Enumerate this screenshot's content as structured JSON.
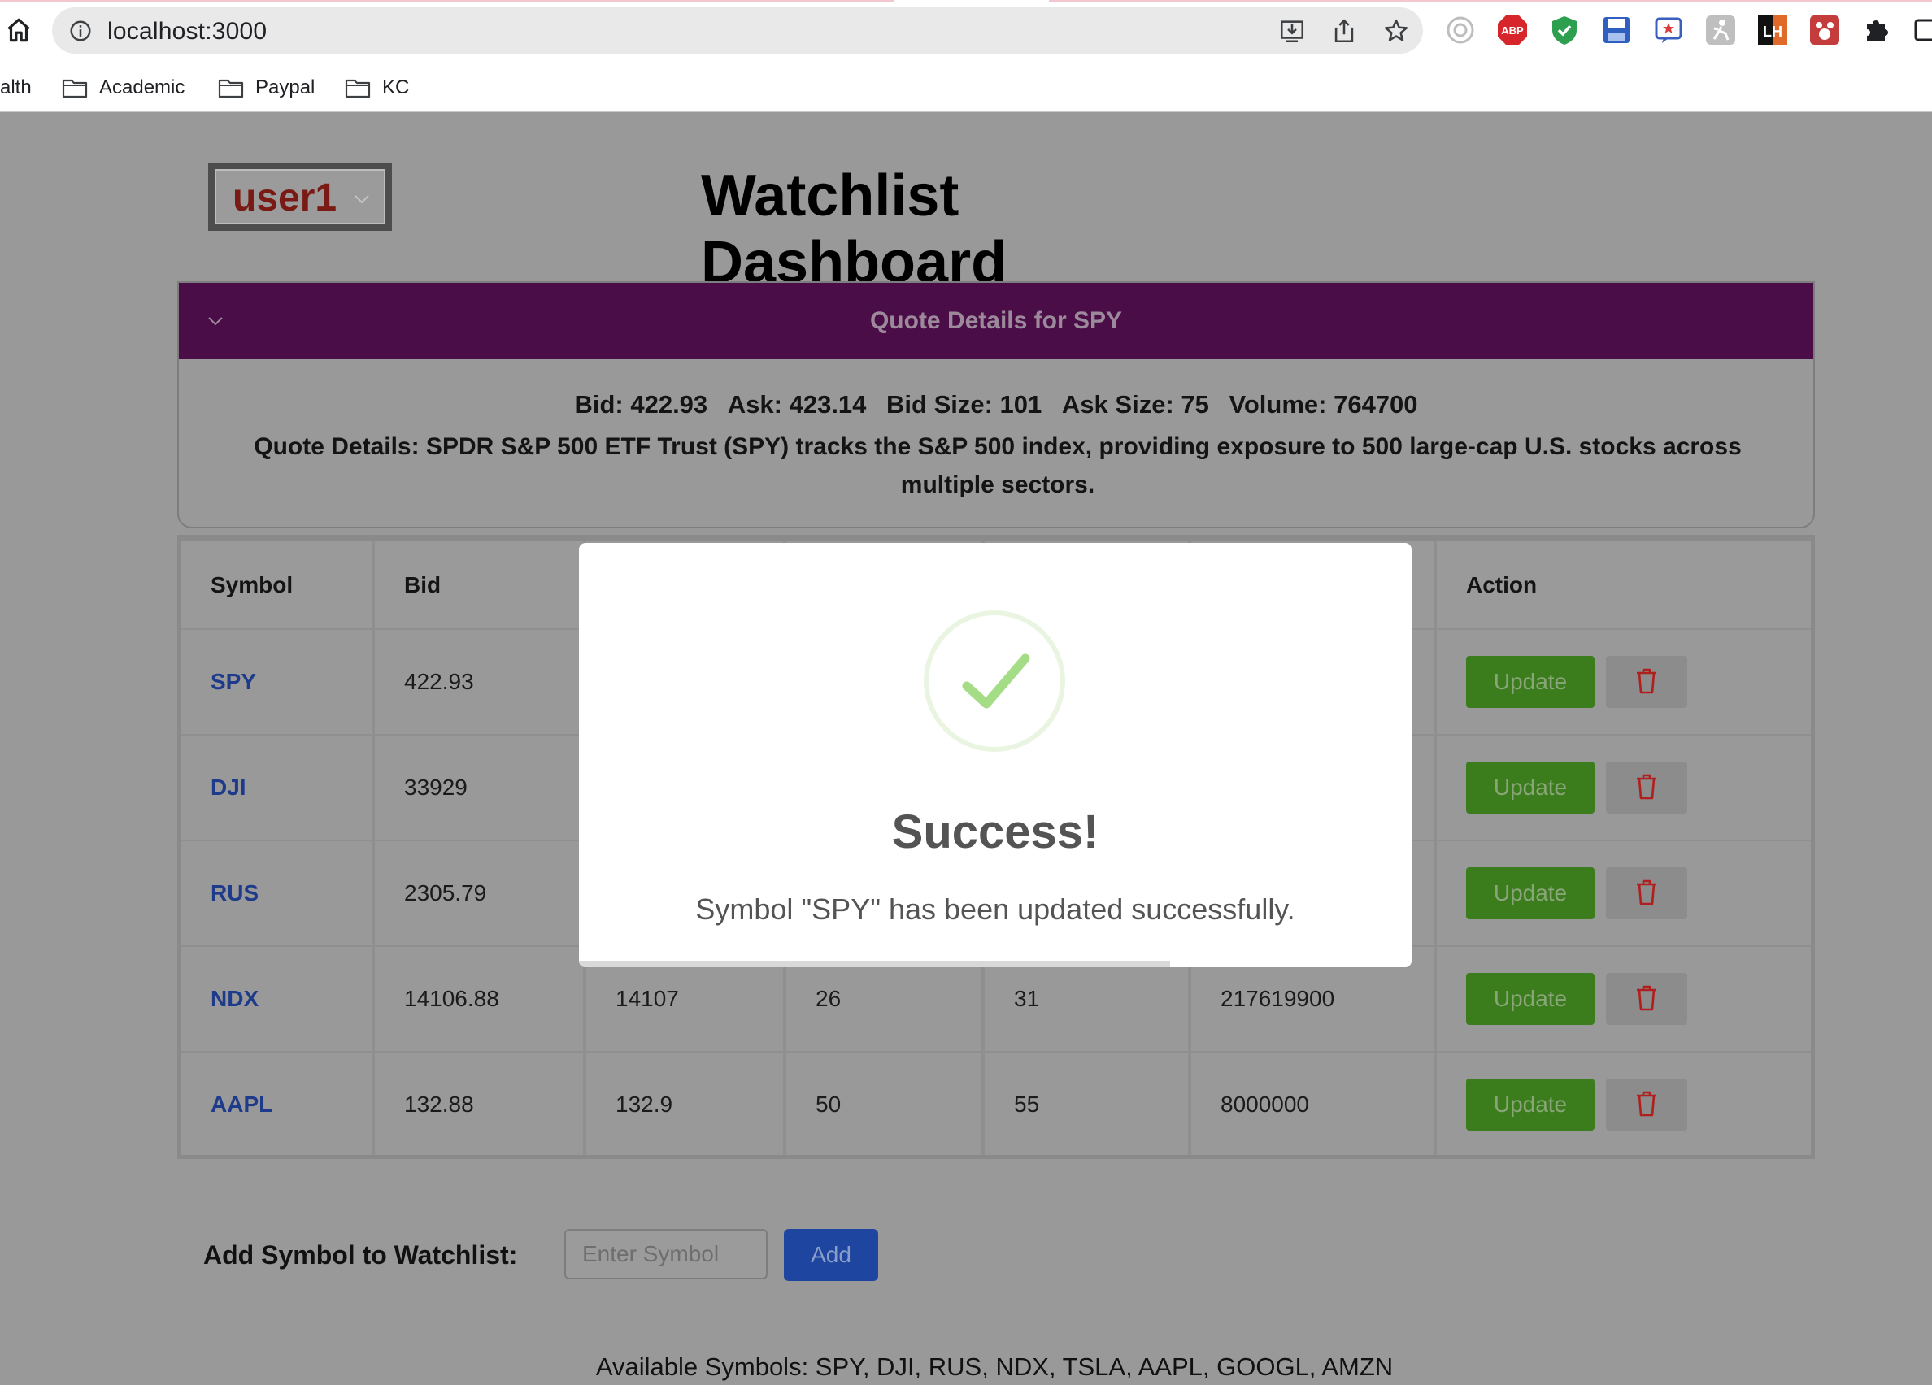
{
  "browser": {
    "url": "localhost:3000",
    "bookmarks": [
      {
        "label": "alth",
        "folder": false
      },
      {
        "label": "Academic",
        "folder": true
      },
      {
        "label": "Paypal",
        "folder": true
      },
      {
        "label": "KC",
        "folder": true
      }
    ],
    "extensions": [
      {
        "icon": "tracker-icon",
        "label": ""
      },
      {
        "icon": "adblock-icon",
        "label": "ABP"
      },
      {
        "icon": "shield-check-icon",
        "label": ""
      },
      {
        "icon": "floppy-disk-icon",
        "label": ""
      },
      {
        "icon": "star-note-icon",
        "label": ""
      },
      {
        "icon": "figure-icon",
        "label": ""
      },
      {
        "icon": "lighthouse-icon",
        "label": "LH"
      },
      {
        "icon": "paw-icon",
        "label": ""
      },
      {
        "icon": "puzzle-icon",
        "label": ""
      },
      {
        "icon": "side-panel-icon",
        "label": ""
      }
    ]
  },
  "header": {
    "user_selected": "user1",
    "title": "Watchlist Dashboard"
  },
  "quote": {
    "title": "Quote Details for SPY",
    "stats": {
      "bid": "Bid: 422.93",
      "ask": "Ask: 423.14",
      "bid_size": "Bid Size: 101",
      "ask_size": "Ask Size: 75",
      "volume": "Volume: 764700"
    },
    "description": "Quote Details: SPDR S&P 500 ETF Trust (SPY) tracks the S&P 500 index, providing exposure to 500 large-cap U.S. stocks across multiple sectors."
  },
  "table": {
    "columns": [
      "Symbol",
      "Bid",
      "",
      "",
      "",
      "",
      "Action"
    ],
    "rows": [
      {
        "symbol": "SPY",
        "bid": "422.93",
        "ask": "",
        "bid_size": "",
        "ask_size": "",
        "volume": ""
      },
      {
        "symbol": "DJI",
        "bid": "33929",
        "ask": "",
        "bid_size": "",
        "ask_size": "",
        "volume": ""
      },
      {
        "symbol": "RUS",
        "bid": "2305.79",
        "ask": "",
        "bid_size": "",
        "ask_size": "",
        "volume": ""
      },
      {
        "symbol": "NDX",
        "bid": "14106.88",
        "ask": "14107",
        "bid_size": "26",
        "ask_size": "31",
        "volume": "217619900"
      },
      {
        "symbol": "AAPL",
        "bid": "132.88",
        "ask": "132.9",
        "bid_size": "50",
        "ask_size": "55",
        "volume": "8000000"
      }
    ],
    "update_label": "Update",
    "delete_icon": "trash-icon"
  },
  "add": {
    "label": "Add Symbol to Watchlist:",
    "placeholder": "Enter Symbol",
    "button": "Add"
  },
  "available": "Available Symbols: SPY, DJI, RUS, NDX, TSLA, AAPL, GOOGL, AMZN",
  "modal": {
    "icon": "check-circle-icon",
    "title": "Success!",
    "message": "Symbol \"SPY\" has been updated successfully.",
    "progress": 0.71
  },
  "colors": {
    "backdrop": "#999999",
    "header_purple": "#4a0d48",
    "update_green": "#3b7d1c",
    "add_blue": "#1e46a0",
    "symbol_blue": "#1e3a8a",
    "success_green": "#a5dc86"
  }
}
